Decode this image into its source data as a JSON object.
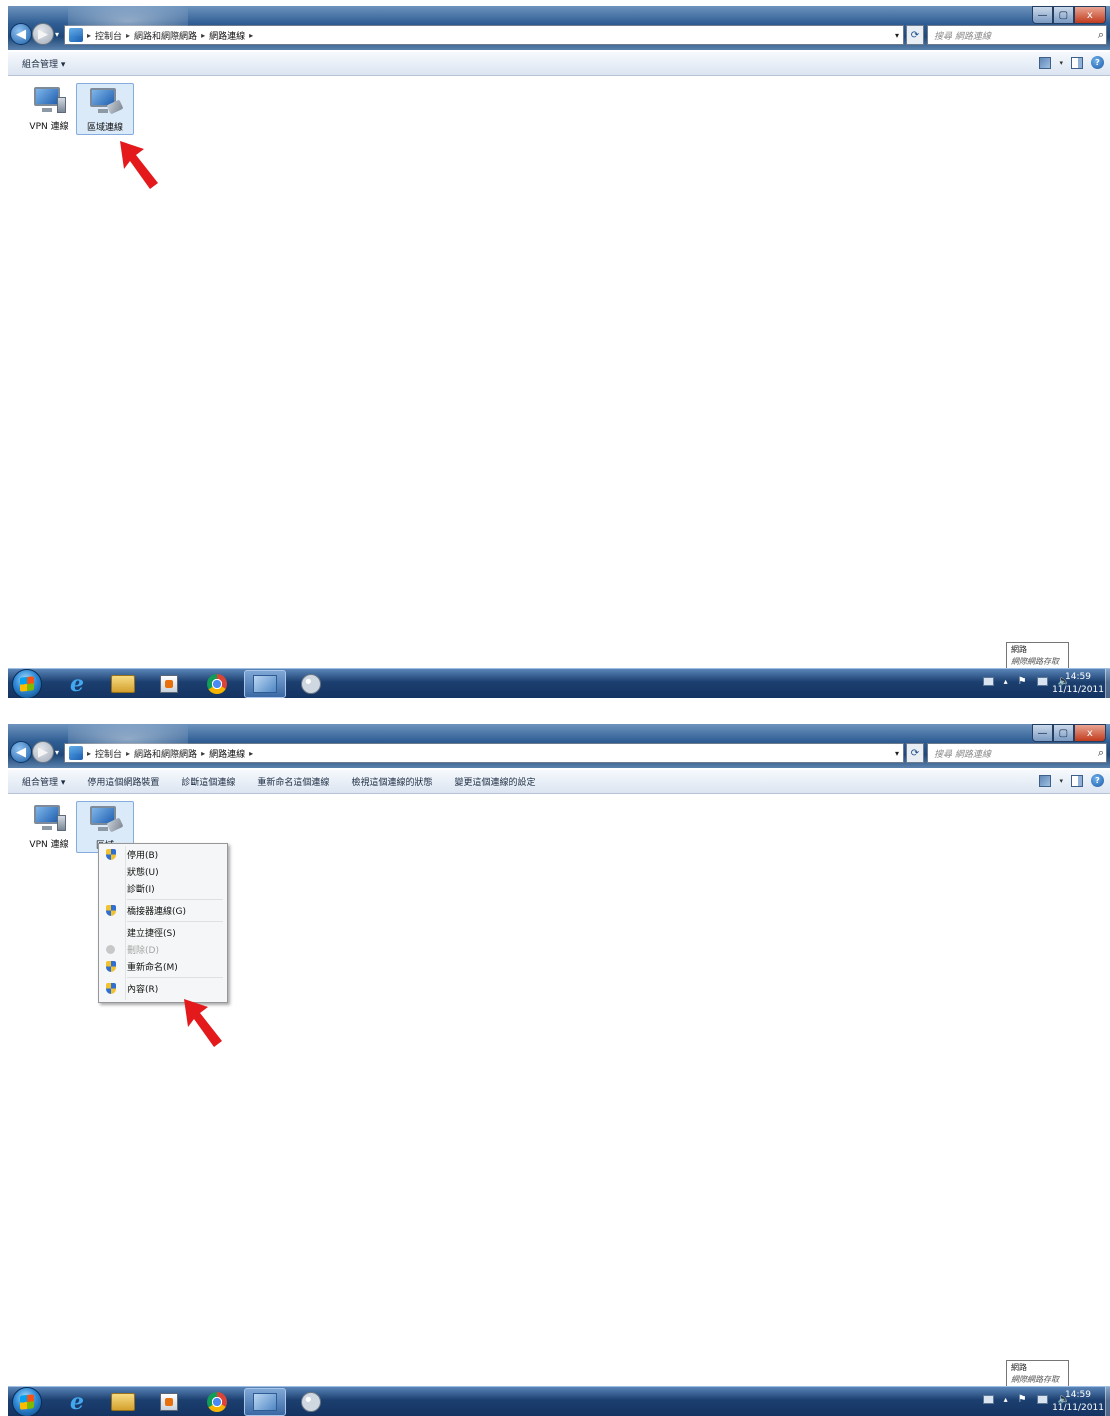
{
  "window": {
    "controls": {
      "minimize": "—",
      "maximize": "▢",
      "close": "x"
    }
  },
  "address_bar": {
    "crumbs": [
      "控制台",
      "網路和網際網路",
      "網路連線"
    ],
    "search_placeholder": "搜尋 網路連線"
  },
  "screens": [
    {
      "command_bar": [
        "組合管理 ▾"
      ],
      "items": [
        {
          "label": "VPN 連線",
          "selected": false
        },
        {
          "label": "區域連線",
          "selected": true
        }
      ],
      "context_menu": null
    },
    {
      "command_bar": [
        "組合管理 ▾",
        "停用這個網路裝置",
        "診斷這個連線",
        "重新命名這個連線",
        "檢視這個連線的狀態",
        "變更這個連線的設定"
      ],
      "items": [
        {
          "label": "VPN 連線",
          "selected": false
        },
        {
          "label": "區域",
          "selected": true
        }
      ],
      "context_menu": {
        "items": [
          {
            "label": "停用(B)",
            "icon": "shield-icon",
            "enabled": true
          },
          {
            "label": "狀態(U)",
            "icon": null,
            "enabled": true
          },
          {
            "label": "診斷(I)",
            "icon": null,
            "enabled": true
          },
          {
            "label": "橋接器連線(G)",
            "icon": "shield-icon",
            "enabled": true
          },
          {
            "label": "建立捷徑(S)",
            "icon": null,
            "enabled": true
          },
          {
            "label": "刪除(D)",
            "icon": "disabled-icon",
            "enabled": false
          },
          {
            "label": "重新命名(M)",
            "icon": "shield-icon",
            "enabled": true
          },
          {
            "label": "內容(R)",
            "icon": "shield-icon",
            "enabled": true
          }
        ]
      }
    }
  ],
  "tray_tooltip": {
    "line1": "網路",
    "line2": "網際網路存取"
  },
  "taskbar": {
    "apps": [
      "internet-explorer-icon",
      "windows-explorer-icon",
      "media-player-icon",
      "chrome-icon",
      "network-connections-icon",
      "paint-icon"
    ],
    "active_app": "network-connections-icon"
  },
  "clock": {
    "time": "14:59",
    "date": "11/11/2011"
  },
  "colors": {
    "accent": "#1f4878",
    "annotation_arrow": "#e3191b",
    "selection": "#dbeaf8"
  }
}
